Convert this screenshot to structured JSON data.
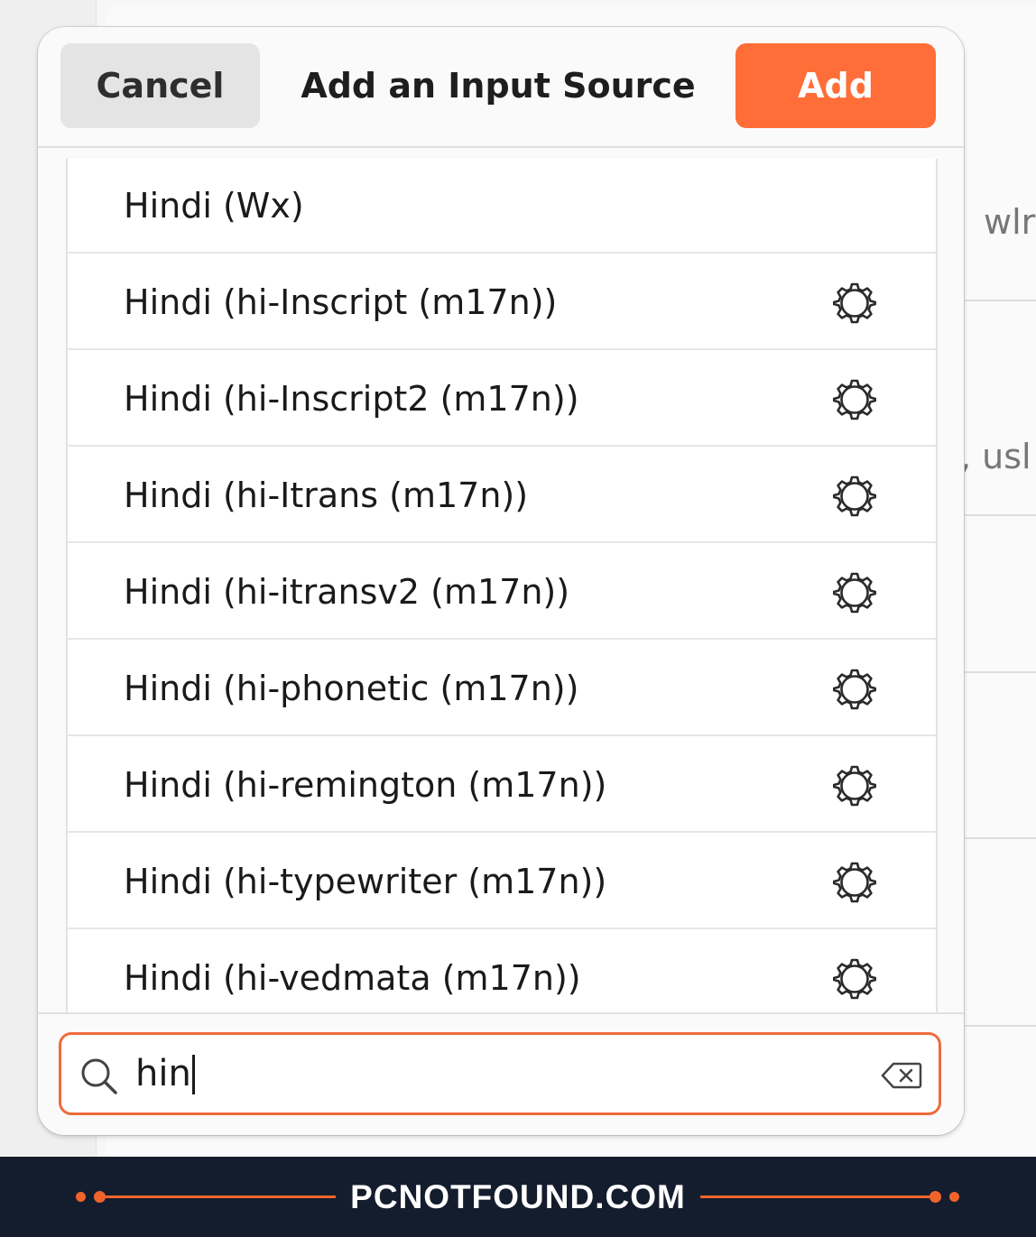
{
  "dialog": {
    "cancel_label": "Cancel",
    "title": "Add an Input Source",
    "add_label": "Add"
  },
  "background": {
    "fragment_1": "wlr",
    "fragment_2": ", usl"
  },
  "list": {
    "items": [
      {
        "label": "Hindi (Wx)",
        "has_settings": false
      },
      {
        "label": "Hindi (hi-Inscript (m17n))",
        "has_settings": true,
        "icon": "gear-icon"
      },
      {
        "label": "Hindi (hi-Inscript2 (m17n))",
        "has_settings": true,
        "icon": "gear-icon"
      },
      {
        "label": "Hindi (hi-Itrans (m17n))",
        "has_settings": true,
        "icon": "gear-icon"
      },
      {
        "label": "Hindi (hi-itransv2 (m17n))",
        "has_settings": true,
        "icon": "gear-icon"
      },
      {
        "label": "Hindi (hi-phonetic (m17n))",
        "has_settings": true,
        "icon": "gear-icon"
      },
      {
        "label": "Hindi (hi-remington (m17n))",
        "has_settings": true,
        "icon": "gear-icon"
      },
      {
        "label": "Hindi (hi-typewriter (m17n))",
        "has_settings": true,
        "icon": "gear-icon"
      },
      {
        "label": "Hindi (hi-vedmata (m17n))",
        "has_settings": true,
        "icon": "gear-icon"
      }
    ]
  },
  "search": {
    "value": "hin",
    "icon": "search-icon",
    "clear_icon": "backspace-clear-icon"
  },
  "banner": {
    "text": "PCNOTFOUND.COM"
  },
  "colors": {
    "accent": "#ff6e38",
    "banner_bg": "#141d2d"
  }
}
